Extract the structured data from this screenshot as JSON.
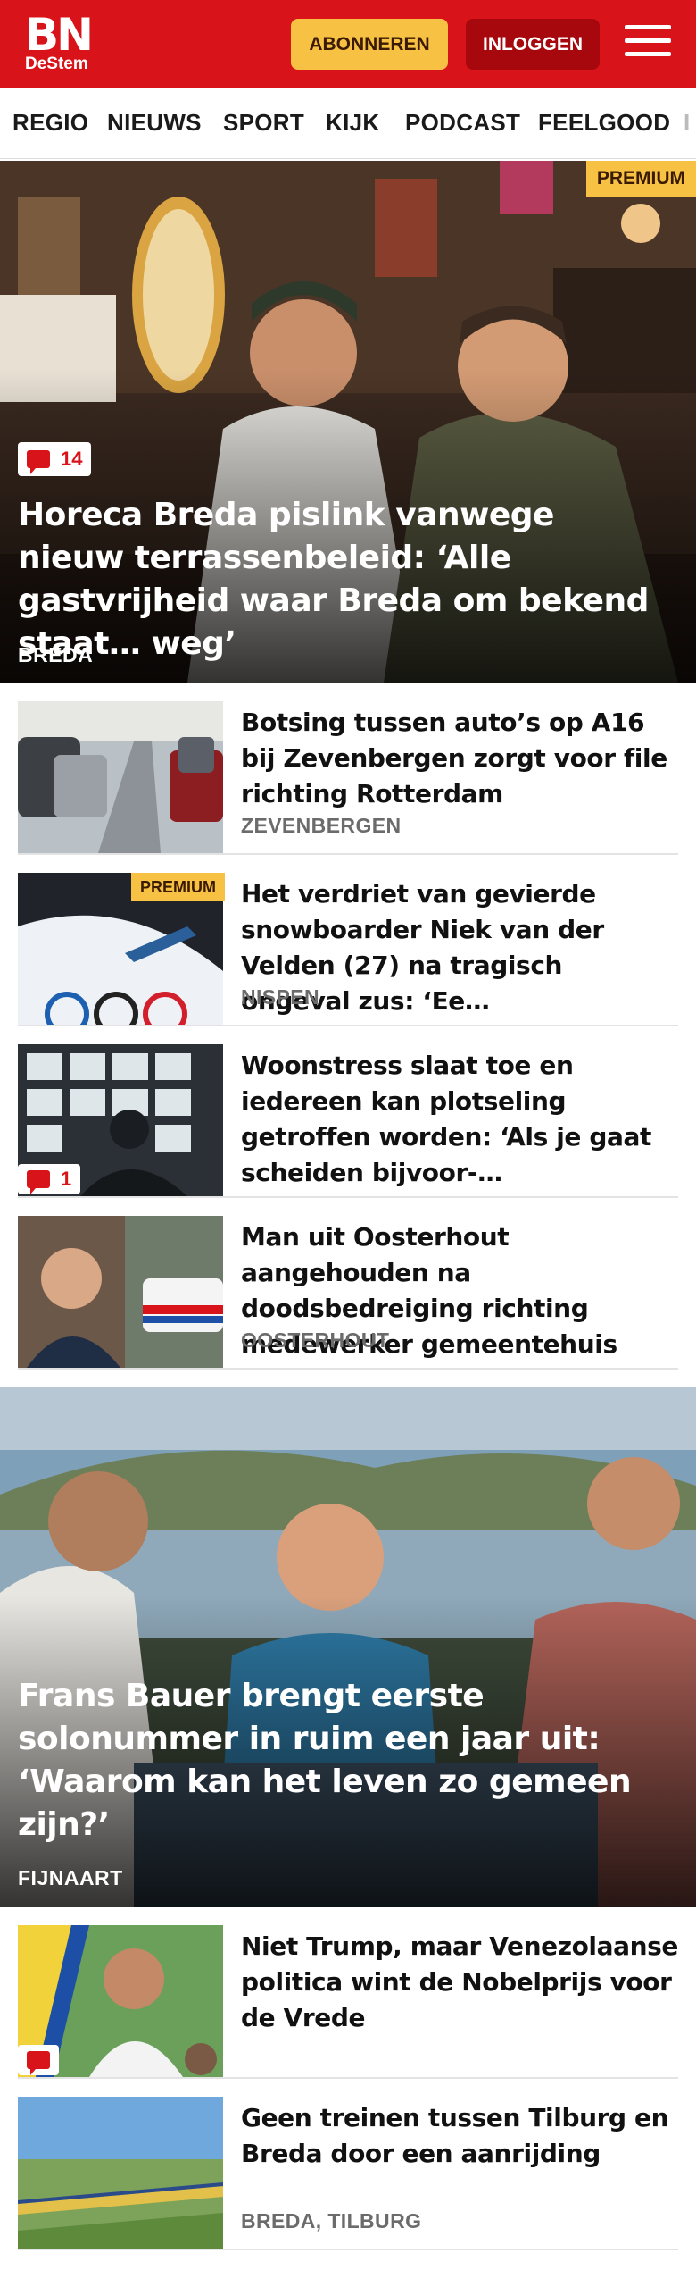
{
  "header": {
    "logo_main": "BN",
    "logo_sub": "DeStem",
    "subscribe_label": "ABONNEREN",
    "login_label": "INLOGGEN",
    "brand_color": "#d8141a",
    "accent_color": "#f7c244"
  },
  "nav": {
    "items": [
      "REGIO",
      "NIEUWS",
      "SPORT",
      "KIJK",
      "PODCAST",
      "FEELGOOD",
      "I"
    ]
  },
  "articles": [
    {
      "title": "Horeca Breda pislink vanwege nieuw terrassenbeleid: ‘Alle gastvrijheid waar Breda om bekend staat… weg’",
      "location": "BREDA",
      "premium": "PREMIUM",
      "comments": "14"
    },
    {
      "title": "Botsing tussen auto’s op A16 bij Zevenbergen zorgt voor file richting Rotterdam",
      "location": "ZEVENBERGEN"
    },
    {
      "title": "Het verdriet van gevierde snowboarder Niek van der Velden (27) na tragisch ongeval zus: ‘Ee…",
      "location": "NISPEN",
      "premium": "PREMIUM"
    },
    {
      "title": "Woonstress slaat toe en iedereen kan plotseling getroffen worden: ‘Als je gaat scheiden bijvoor-…",
      "comments": "1"
    },
    {
      "title": "Man uit Oosterhout aangehouden na doodsbedreiging richting medewerker gemeentehuis",
      "location": "OOSTERHOUT"
    },
    {
      "title": "Frans Bauer brengt eerste solonummer in ruim een jaar uit: ‘Waarom kan het leven zo gemeen zijn?’",
      "location": "FIJNAART"
    },
    {
      "title": "Niet Trump, maar Venezolaanse politica wint de Nobelprijs voor de Vrede"
    },
    {
      "title": "Geen treinen tussen Tilburg en Breda door een aanrijding",
      "location": "BREDA, TILBURG"
    }
  ]
}
